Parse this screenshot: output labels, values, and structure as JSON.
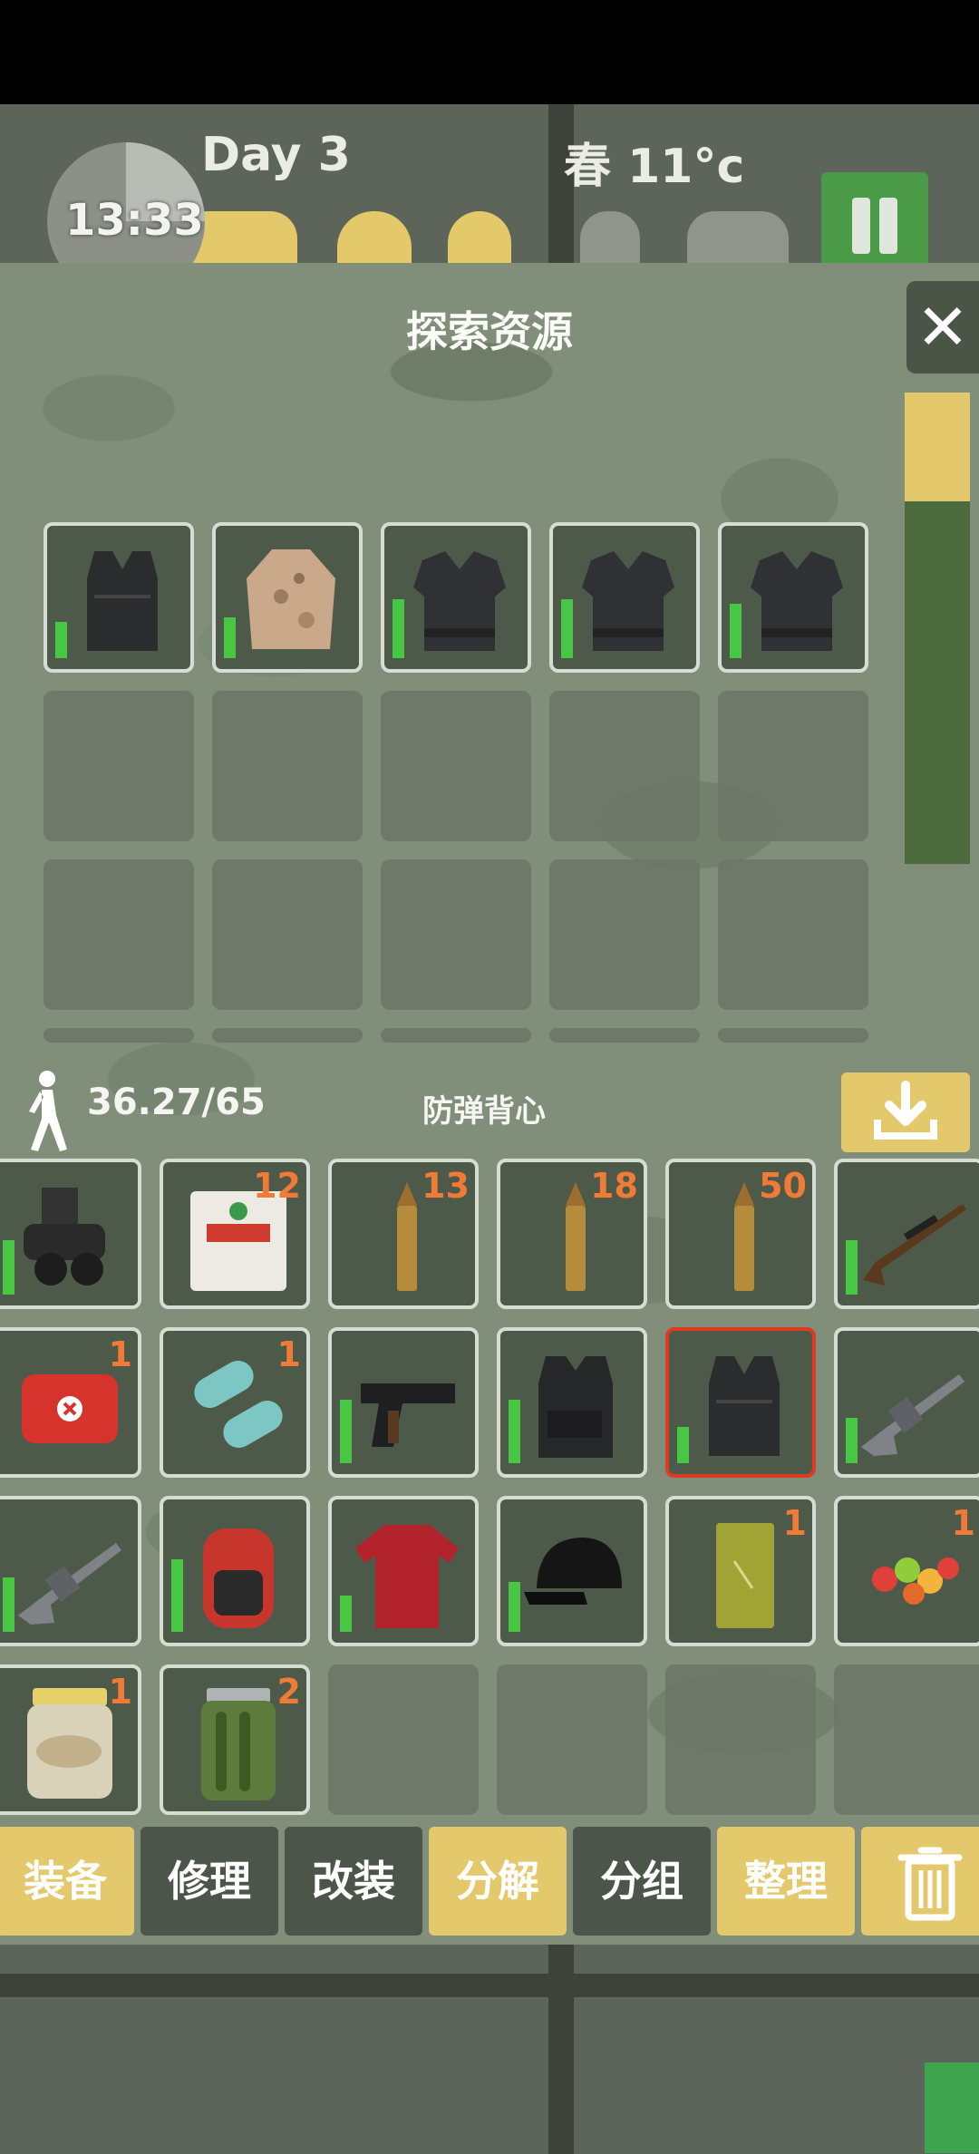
{
  "hud": {
    "clock": "13:33",
    "day": "Day 3",
    "weather": "春  11°c"
  },
  "panel": {
    "title": "探索资源",
    "close_label": "✕"
  },
  "loot_slots": [
    {
      "name": "body-armor-vest",
      "qty": "",
      "durability": 0.4
    },
    {
      "name": "camo-jacket",
      "qty": "",
      "durability": 0.45
    },
    {
      "name": "heavy-armor-vest",
      "qty": "",
      "durability": 0.65
    },
    {
      "name": "heavy-armor-vest",
      "qty": "",
      "durability": 0.65
    },
    {
      "name": "heavy-armor-vest",
      "qty": "",
      "durability": 0.6
    }
  ],
  "weight": {
    "current_over_max": "36.27/65",
    "selected_item": "防弹背心"
  },
  "backpack_items": [
    {
      "name": "night-vision-goggles",
      "qty": "",
      "durability": 0.6
    },
    {
      "name": "compressed-biscuit",
      "qty": "12",
      "durability": null
    },
    {
      "name": "rifle-ammo",
      "qty": "13",
      "durability": null
    },
    {
      "name": "rifle-ammo",
      "qty": "18",
      "durability": null
    },
    {
      "name": "rifle-ammo",
      "qty": "50",
      "durability": null
    },
    {
      "name": "sniper-rifle",
      "qty": "",
      "durability": 0.6
    },
    {
      "name": "first-aid-kit",
      "qty": "1",
      "durability": null
    },
    {
      "name": "capsules",
      "qty": "1",
      "durability": null
    },
    {
      "name": "pistol",
      "qty": "",
      "durability": 0.7
    },
    {
      "name": "tactical-vest",
      "qty": "",
      "durability": 0.7
    },
    {
      "name": "body-armor-vest",
      "qty": "",
      "durability": 0.4
    },
    {
      "name": "assault-rifle",
      "qty": "",
      "durability": 0.5
    },
    {
      "name": "assault-rifle",
      "qty": "",
      "durability": 0.6
    },
    {
      "name": "red-backpack",
      "qty": "",
      "durability": 0.8
    },
    {
      "name": "red-sweater",
      "qty": "",
      "durability": 0.4
    },
    {
      "name": "black-cap",
      "qty": "",
      "durability": 0.55
    },
    {
      "name": "snack-pack",
      "qty": "1",
      "durability": null
    },
    {
      "name": "gummy-candy",
      "qty": "1",
      "durability": null
    },
    {
      "name": "preserved-food-jar",
      "qty": "1",
      "durability": null
    },
    {
      "name": "pickle-jar",
      "qty": "2",
      "durability": null
    }
  ],
  "actions": [
    {
      "label": "装备",
      "style": "yellow"
    },
    {
      "label": "修理",
      "style": "dark"
    },
    {
      "label": "改装",
      "style": "dark"
    },
    {
      "label": "分解",
      "style": "yellow"
    },
    {
      "label": "分组",
      "style": "dark"
    },
    {
      "label": "整理",
      "style": "yellow"
    },
    {
      "label": "",
      "style": "yellow",
      "icon": "trash-icon"
    }
  ],
  "colors": {
    "accent_yellow": "#e3c96c",
    "durability_green": "#47c743",
    "quantity_orange": "#f07b36",
    "selection_red": "#e13a22"
  }
}
